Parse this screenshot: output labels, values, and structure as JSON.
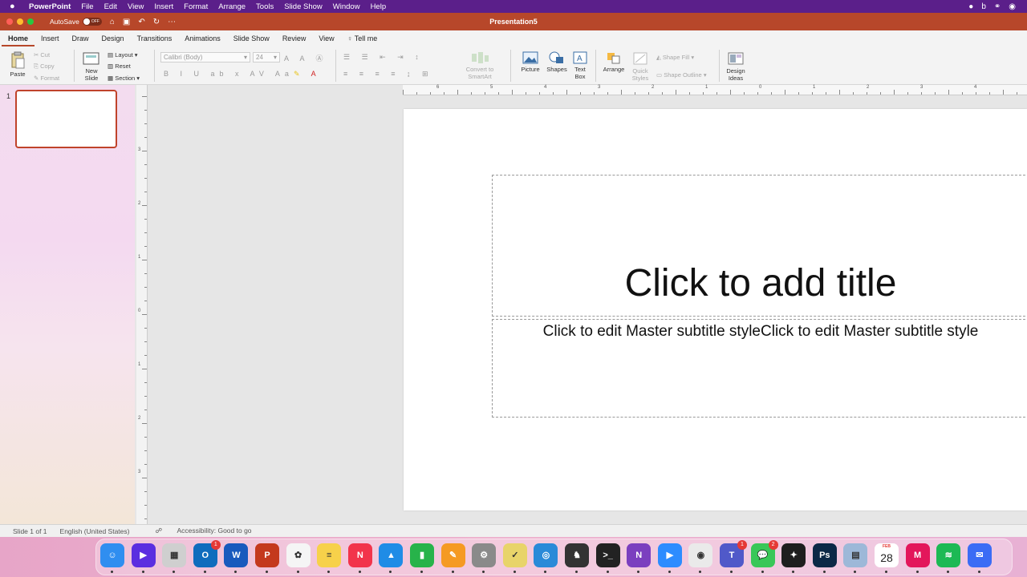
{
  "menubar": {
    "app_name": "PowerPoint",
    "items": [
      "File",
      "Edit",
      "View",
      "Insert",
      "Format",
      "Arrange",
      "Tools",
      "Slide Show",
      "Window",
      "Help"
    ]
  },
  "titlebar": {
    "autosave_label": "AutoSave",
    "autosave_state": "OFF",
    "doc_title": "Presentation5"
  },
  "tabs": [
    "Home",
    "Insert",
    "Draw",
    "Design",
    "Transitions",
    "Animations",
    "Slide Show",
    "Review",
    "View"
  ],
  "tell_me": "Tell me",
  "ribbon": {
    "paste": "Paste",
    "cut": "Cut",
    "copy": "Copy",
    "format": "Format",
    "new_slide_1": "New",
    "new_slide_2": "Slide",
    "layout": "Layout",
    "reset": "Reset",
    "section": "Section",
    "font_name": "Calibri (Body)",
    "font_size": "24",
    "convert_1": "Convert to",
    "convert_2": "SmartArt",
    "picture": "Picture",
    "shapes": "Shapes",
    "textbox_1": "Text",
    "textbox_2": "Box",
    "arrange": "Arrange",
    "quick_styles_1": "Quick",
    "quick_styles_2": "Styles",
    "shape_fill": "Shape Fill",
    "shape_outline": "Shape Outline",
    "design_ideas_1": "Design",
    "design_ideas_2": "Ideas"
  },
  "thumbnails": {
    "number": "1"
  },
  "ruler": {
    "h": [
      "6",
      "5",
      "4",
      "3",
      "2",
      "1",
      "0",
      "1",
      "2",
      "3",
      "4"
    ],
    "v": [
      "3",
      "2",
      "1",
      "0",
      "1",
      "2",
      "3"
    ]
  },
  "slide": {
    "title_placeholder": "Click to add title",
    "subtitle_placeholder": "Click to edit Master subtitle styleClick to edit Master subtitle style"
  },
  "status": {
    "slide": "Slide 1 of 1",
    "language": "English (United States)",
    "accessibility": "Accessibility: Good to go"
  },
  "dock": {
    "apps": [
      {
        "name": "finder",
        "color": "#2f8ef0",
        "glyph": "☺"
      },
      {
        "name": "prime",
        "color": "#5b2ee0",
        "glyph": "▶"
      },
      {
        "name": "launchpad",
        "color": "#cfcfcf",
        "glyph": "▦"
      },
      {
        "name": "outlook",
        "color": "#0f6cbd",
        "glyph": "O",
        "badge": "1"
      },
      {
        "name": "word",
        "color": "#185abd",
        "glyph": "W"
      },
      {
        "name": "powerpoint",
        "color": "#c4391d",
        "glyph": "P"
      },
      {
        "name": "photos",
        "color": "#f5f5f5",
        "glyph": "✿"
      },
      {
        "name": "notes",
        "color": "#f7d14a",
        "glyph": "≡"
      },
      {
        "name": "news",
        "color": "#f2344b",
        "glyph": "N"
      },
      {
        "name": "keynote",
        "color": "#1f8ce6",
        "glyph": "▲"
      },
      {
        "name": "numbers",
        "color": "#27b34a",
        "glyph": "▮"
      },
      {
        "name": "pages",
        "color": "#f59a23",
        "glyph": "✎"
      },
      {
        "name": "system-settings",
        "color": "#8a8a8a",
        "glyph": "⚙"
      },
      {
        "name": "taskheat",
        "color": "#e8d46a",
        "glyph": "✓"
      },
      {
        "name": "aperture",
        "color": "#2a8ad8",
        "glyph": "◎"
      },
      {
        "name": "inkscape",
        "color": "#333333",
        "glyph": "♞"
      },
      {
        "name": "terminal",
        "color": "#222222",
        "glyph": ">_"
      },
      {
        "name": "onenote",
        "color": "#7b3fbf",
        "glyph": "N"
      },
      {
        "name": "zoom",
        "color": "#2d8cff",
        "glyph": "▶"
      },
      {
        "name": "chrome",
        "color": "#eaeaea",
        "glyph": "◉"
      },
      {
        "name": "teams",
        "color": "#5059c9",
        "glyph": "T",
        "badge": "1"
      },
      {
        "name": "messages",
        "color": "#39c758",
        "glyph": "💬",
        "badge": "2"
      },
      {
        "name": "figma",
        "color": "#1e1e1e",
        "glyph": "✦"
      },
      {
        "name": "photoshop",
        "color": "#0b2846",
        "glyph": "Ps"
      },
      {
        "name": "preview",
        "color": "#9db8d8",
        "glyph": "▤"
      },
      {
        "name": "calendar",
        "color": "#ffffff",
        "glyph": "28"
      },
      {
        "name": "mela",
        "color": "#e3165b",
        "glyph": "M"
      },
      {
        "name": "spotify",
        "color": "#1db954",
        "glyph": "≋"
      },
      {
        "name": "messenger",
        "color": "#3b6cf5",
        "glyph": "✉"
      }
    ],
    "calendar_month": "FEB"
  }
}
